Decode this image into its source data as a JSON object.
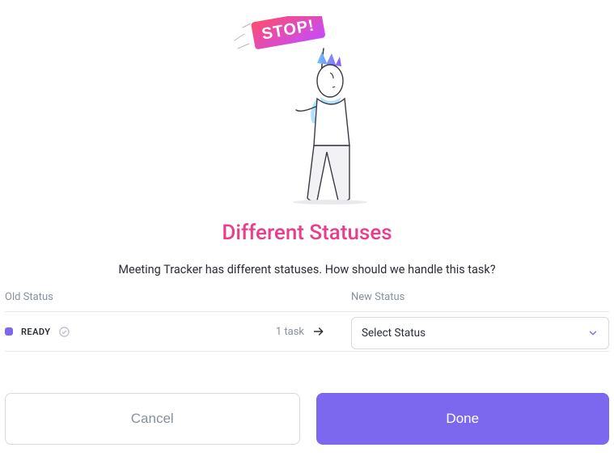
{
  "illustration": {
    "sign_text": "STOP!"
  },
  "title": "Different Statuses",
  "subtitle": "Meeting Tracker has different statuses. How should we handle this task?",
  "headers": {
    "old": "Old Status",
    "new": "New Status"
  },
  "status_row": {
    "color": "#7b68ee",
    "name": "READY",
    "task_count": "1 task",
    "select_placeholder": "Select Status"
  },
  "buttons": {
    "cancel": "Cancel",
    "done": "Done"
  }
}
